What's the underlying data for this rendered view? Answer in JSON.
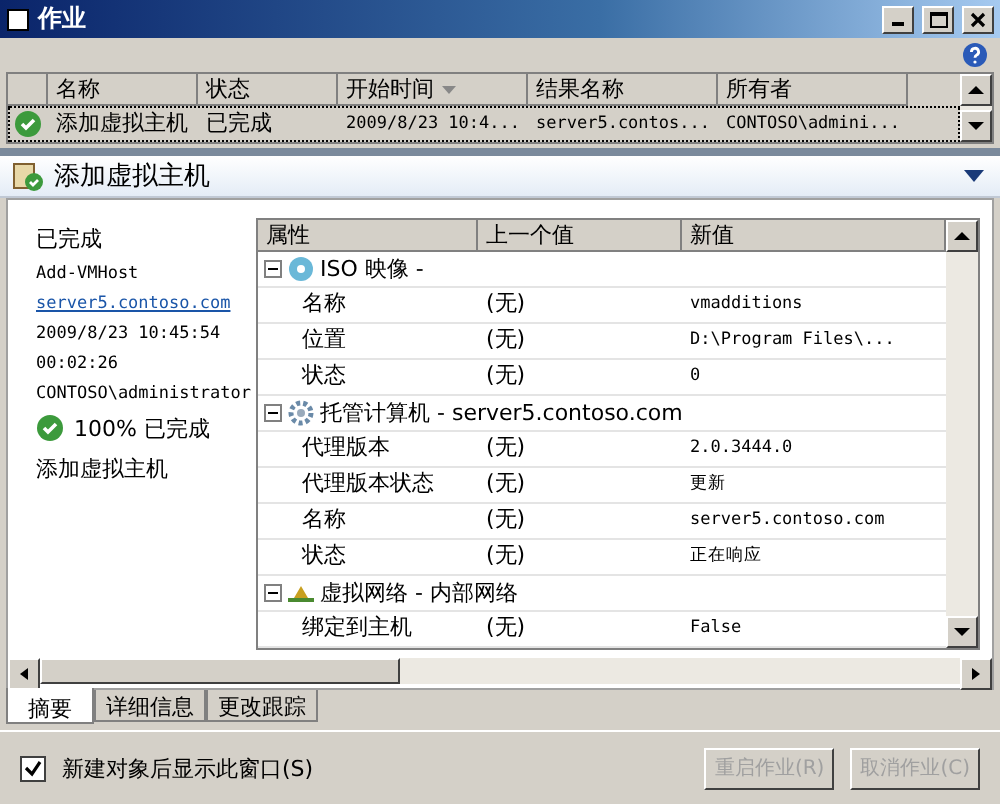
{
  "window": {
    "title": "作业"
  },
  "jobs": {
    "columns": [
      {
        "label": "名称",
        "sorted": false
      },
      {
        "label": "状态",
        "sorted": false
      },
      {
        "label": "开始时间",
        "sorted": true
      },
      {
        "label": "结果名称",
        "sorted": false
      },
      {
        "label": "所有者",
        "sorted": false
      }
    ],
    "rows": [
      {
        "selected": true,
        "cells": [
          "添加虚拟主机",
          "已完成",
          "2009/8/23 10:4...",
          "server5.contos...",
          "CONTOSO\\admini..."
        ]
      }
    ]
  },
  "detail": {
    "title": "添加虚拟主机",
    "expanded": true,
    "summary": [
      {
        "kind": "text",
        "text": "已完成"
      },
      {
        "kind": "mono",
        "text": "Add-VMHost"
      },
      {
        "kind": "link",
        "text": "server5.contoso.com"
      },
      {
        "kind": "mono",
        "text": "2009/8/23 10:45:54"
      },
      {
        "kind": "mono",
        "text": "00:02:26"
      },
      {
        "kind": "mono",
        "text": "CONTOSO\\administrator"
      },
      {
        "kind": "progress",
        "text": "100% 已完成"
      },
      {
        "kind": "text",
        "text": "添加虚拟主机"
      }
    ],
    "properties": {
      "columns": [
        "属性",
        "上一个值",
        "新值"
      ],
      "groups": [
        {
          "label": "ISO 映像 -",
          "expanded": true,
          "children": [
            {
              "name": "名称",
              "previous": "(无)",
              "value": "vmadditions"
            },
            {
              "name": "位置",
              "previous": "(无)",
              "value": "D:\\Program Files\\..."
            },
            {
              "name": "状态",
              "previous": "(无)",
              "value": "0"
            }
          ]
        },
        {
          "label": "托管计算机 - server5.contoso.com",
          "expanded": true,
          "children": [
            {
              "name": "代理版本",
              "previous": "(无)",
              "value": "2.0.3444.0"
            },
            {
              "name": "代理版本状态",
              "previous": "(无)",
              "value": "更新"
            },
            {
              "name": "名称",
              "previous": "(无)",
              "value": "server5.contoso.com"
            },
            {
              "name": "状态",
              "previous": "(无)",
              "value": "正在响应"
            }
          ]
        },
        {
          "label": "虚拟网络 - 内部网络",
          "expanded": true,
          "children": [
            {
              "name": "绑定到主机",
              "previous": "(无)",
              "value": "False"
            }
          ]
        }
      ]
    }
  },
  "tabs": [
    {
      "label": "摘要",
      "selected": true
    },
    {
      "label": "详细信息",
      "selected": false
    },
    {
      "label": "更改跟踪",
      "selected": false
    }
  ],
  "show_window_checkbox": {
    "label": "新建对象后显示此窗口(S)",
    "checked": true
  },
  "buttons": [
    {
      "label": "重启作业(R)",
      "disabled": true
    },
    {
      "label": "取消作业(C)",
      "disabled": true
    }
  ]
}
